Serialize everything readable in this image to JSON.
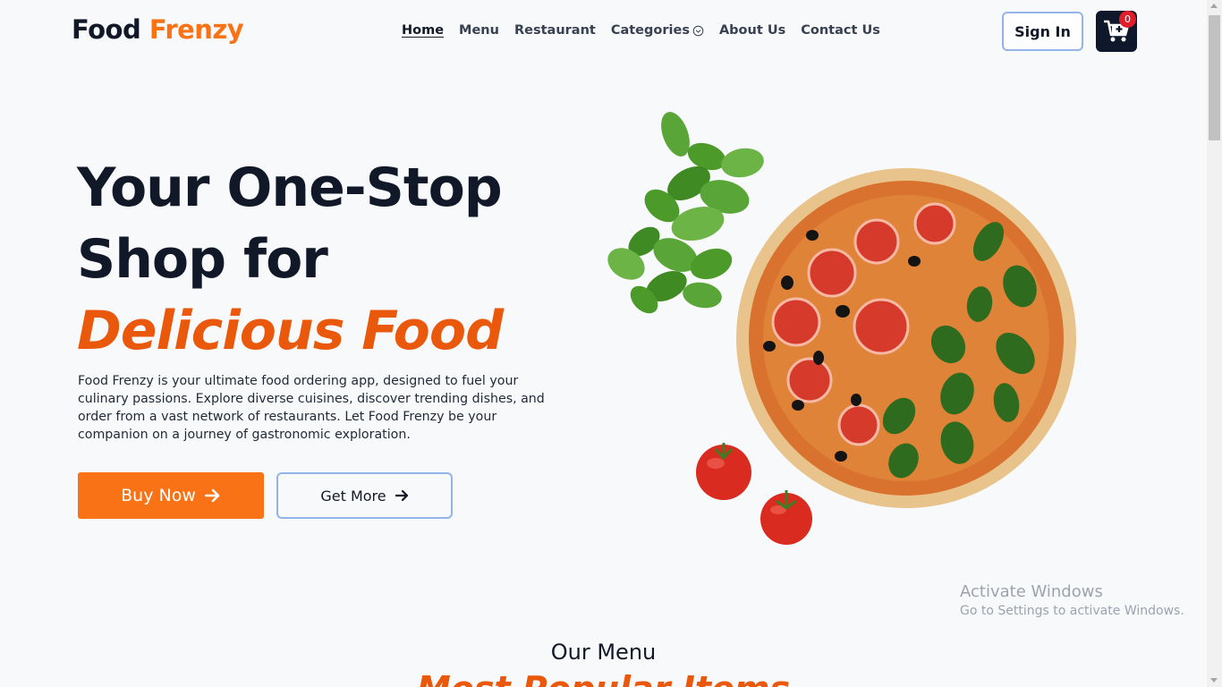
{
  "brand": {
    "part1": "Food",
    "part2": "Frenzy"
  },
  "nav": {
    "home": "Home",
    "menu": "Menu",
    "restaurant": "Restaurant",
    "categories": "Categories",
    "about": "About Us",
    "contact": "Contact Us"
  },
  "header": {
    "signin_label": "Sign In",
    "cart_count": "0"
  },
  "hero": {
    "line1": "Your One-Stop",
    "line2": "Shop for",
    "line3": "Delicious Food",
    "description": "Food Frenzy is your ultimate food ordering app, designed to fuel your culinary passions. Explore diverse cuisines, discover trending dishes, and order from a vast network of restaurants. Let Food Frenzy be your companion on a journey of gastronomic exploration.",
    "buy_label": "Buy Now",
    "more_label": "Get More"
  },
  "section": {
    "title": "Our Menu",
    "subtitle": "Most Popular Items"
  },
  "watermark": {
    "line1": "Activate Windows",
    "line2": "Go to Settings to activate Windows."
  },
  "colors": {
    "accent": "#f97316",
    "accent_dark": "#ea580c",
    "dark": "#0f172a",
    "badge": "#e11d2a"
  },
  "icons": {
    "cart": "cart-icon",
    "arrow": "arrow-right-icon",
    "chevron": "chevron-down-icon"
  }
}
